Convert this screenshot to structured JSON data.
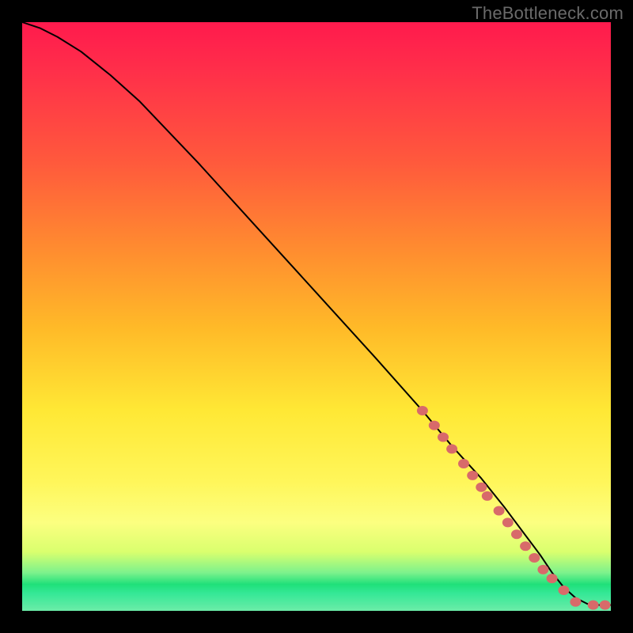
{
  "watermark": "TheBottleneck.com",
  "chart_data": {
    "type": "line",
    "title": "",
    "xlabel": "",
    "ylabel": "",
    "xlim": [
      0,
      100
    ],
    "ylim": [
      0,
      100
    ],
    "grid": false,
    "legend": false,
    "series": [
      {
        "name": "curve",
        "x": [
          0,
          3,
          6,
          10,
          15,
          20,
          30,
          40,
          50,
          60,
          68,
          73,
          78,
          82,
          85,
          88,
          90,
          92,
          94,
          96,
          98,
          100
        ],
        "y": [
          100,
          99,
          97.5,
          95,
          91,
          86.5,
          76,
          65,
          54,
          43,
          34,
          28,
          22.5,
          17.5,
          13.5,
          9.5,
          6.5,
          4,
          2.2,
          1.2,
          1.0,
          1.0
        ]
      }
    ],
    "markers": {
      "name": "highlighted-points",
      "color": "#d86a6a",
      "x": [
        68,
        70,
        71.5,
        73,
        75,
        76.5,
        78,
        79,
        81,
        82.5,
        84,
        85.5,
        87,
        88.5,
        90,
        92,
        94,
        97,
        99
      ],
      "y": [
        34,
        31.5,
        29.5,
        27.5,
        25,
        23,
        21,
        19.5,
        17,
        15,
        13,
        11,
        9,
        7,
        5.5,
        3.5,
        1.5,
        1.0,
        1.0
      ]
    },
    "background": {
      "type": "vertical-gradient",
      "stops": [
        {
          "pos": 0.0,
          "color": "#ff1a4d"
        },
        {
          "pos": 0.38,
          "color": "#ff8a30"
        },
        {
          "pos": 0.66,
          "color": "#ffe835"
        },
        {
          "pos": 0.9,
          "color": "#d9ff6e"
        },
        {
          "pos": 0.955,
          "color": "#1fe07a"
        },
        {
          "pos": 1.0,
          "color": "#6ceca8"
        }
      ]
    }
  }
}
